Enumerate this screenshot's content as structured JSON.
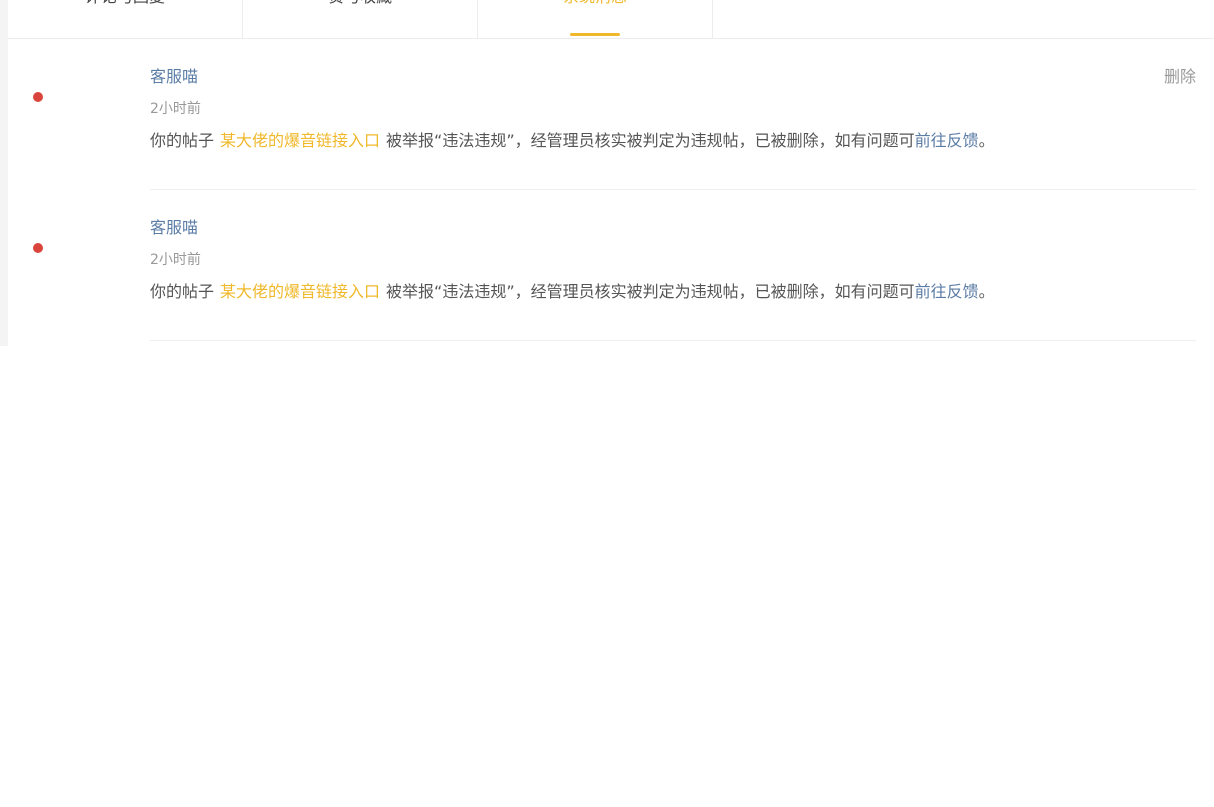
{
  "tabs": [
    {
      "label": "评论与回复",
      "active": false
    },
    {
      "label": "赞与收藏",
      "active": false
    },
    {
      "label": "系统消息",
      "active": true
    }
  ],
  "messages": [
    {
      "sender": "客服喵",
      "time": "2小时前",
      "prefix": "你的帖子",
      "post_title": "某大佬的爆音链接入口",
      "body": "被举报“违法违规”，经管理员核实被判定为违规帖，已被删除，如有问题可",
      "feedback_link": "前往反馈",
      "suffix": "。",
      "delete_label": "删除",
      "unread": true
    },
    {
      "sender": "客服喵",
      "time": "2小时前",
      "prefix": "你的帖子",
      "post_title": "某大佬的爆音链接入口",
      "body": "被举报“违法违规”，经管理员核实被判定为违规帖，已被删除，如有问题可",
      "feedback_link": "前往反馈",
      "suffix": "。",
      "delete_label": "",
      "unread": true
    }
  ],
  "colors": {
    "accent": "#f0b92c",
    "link": "#5b7ca5",
    "unread_dot": "#d9453d"
  }
}
